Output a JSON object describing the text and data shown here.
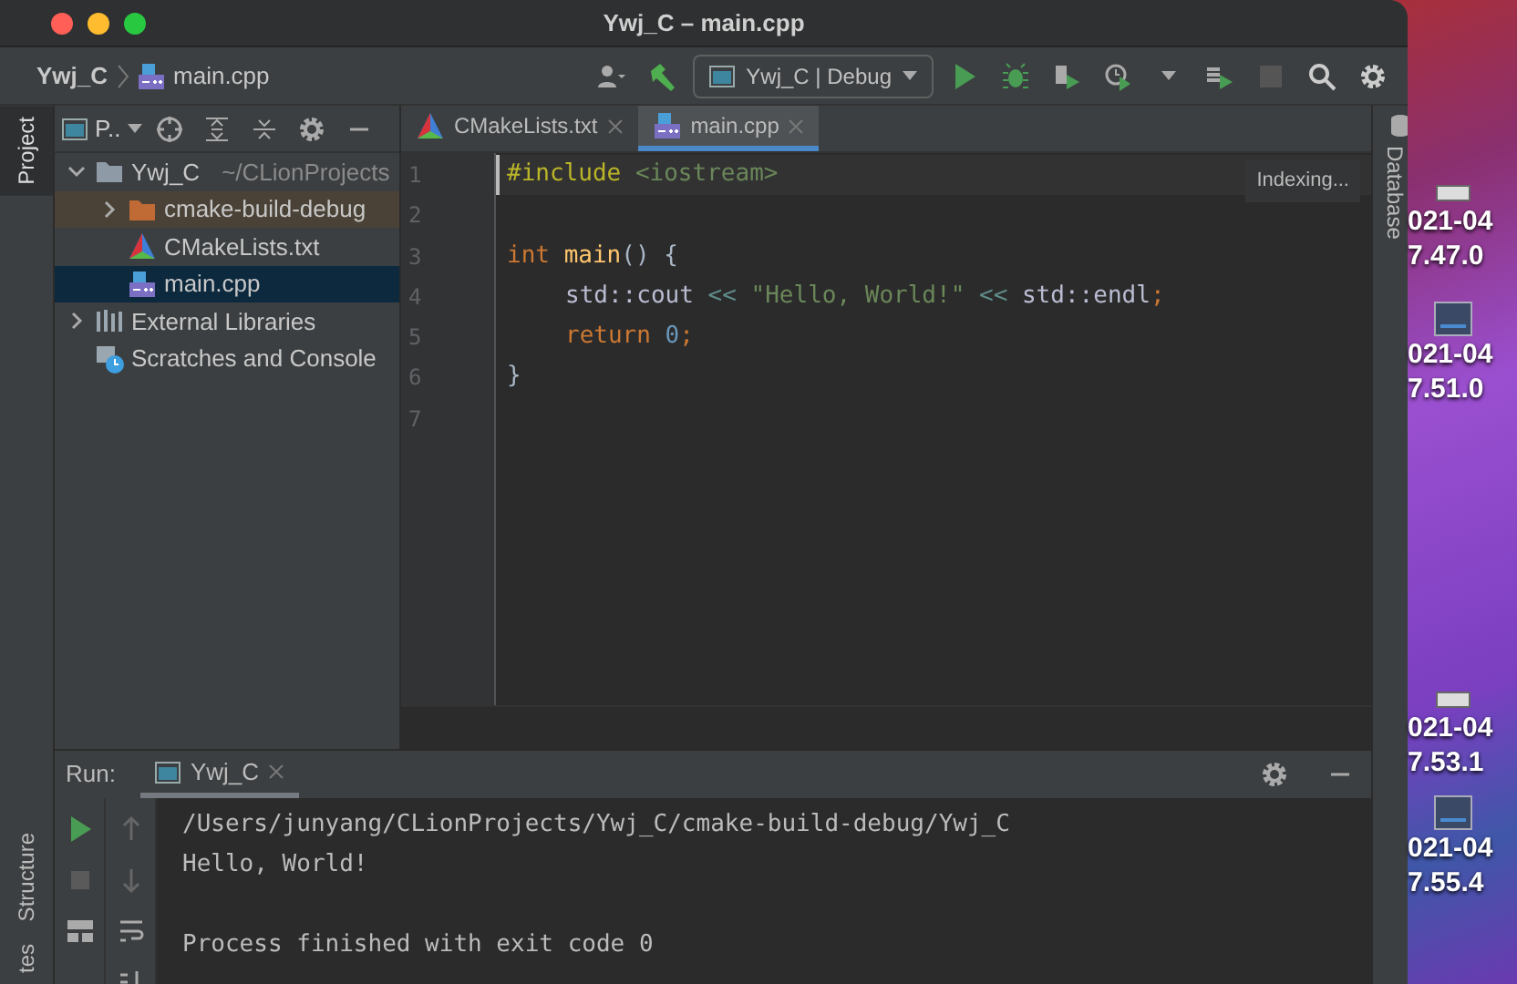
{
  "window": {
    "title": "Ywj_C – main.cpp"
  },
  "breadcrumb": [
    {
      "label": "Ywj_C",
      "kind": "project"
    },
    {
      "label": "main.cpp",
      "kind": "cpp"
    }
  ],
  "run_config": {
    "label": "Ywj_C | Debug"
  },
  "left_strip": {
    "top": [
      {
        "label": "Project",
        "selected": true
      }
    ],
    "bottom": [
      {
        "label": "Structure",
        "selected": false
      },
      {
        "label": "tes",
        "selected": false
      }
    ]
  },
  "right_strip": [
    {
      "label": "Database"
    }
  ],
  "project_panel": {
    "title": "P..",
    "tree": [
      {
        "label": "Ywj_C",
        "hint": "~/CLionProjects",
        "kind": "folder",
        "expanded": true,
        "selected": false,
        "children": [
          {
            "label": "cmake-build-debug",
            "kind": "excluded_folder",
            "expanded": false,
            "selected": false
          },
          {
            "label": "CMakeLists.txt",
            "kind": "cmake",
            "selected": false
          },
          {
            "label": "main.cpp",
            "kind": "cpp",
            "selected": true
          }
        ]
      },
      {
        "label": "External Libraries",
        "kind": "libraries",
        "expanded": false,
        "selected": false
      },
      {
        "label": "Scratches and Console",
        "kind": "scratches",
        "selected": false
      }
    ]
  },
  "editor": {
    "tabs": [
      {
        "label": "CMakeLists.txt",
        "kind": "cmake",
        "selected": false
      },
      {
        "label": "main.cpp",
        "kind": "cpp",
        "selected": true
      }
    ],
    "status": "Indexing...",
    "lines": [
      {
        "number": "1",
        "current": true,
        "tokens": [
          {
            "kind": "directive",
            "text": "#include "
          },
          {
            "kind": "header",
            "text": "<iostream>"
          }
        ]
      },
      {
        "number": "2",
        "current": false
      },
      {
        "number": "3",
        "current": false,
        "tokens": [
          {
            "kind": "keyword",
            "text": "int "
          },
          {
            "kind": "function",
            "text": "main"
          },
          {
            "kind": "plain",
            "text": "() {"
          }
        ]
      },
      {
        "number": "4",
        "current": false,
        "kind": "body",
        "tokens": [
          {
            "kind": "symbol",
            "text": "std::cout"
          },
          {
            "kind": "operator",
            "text": " << "
          },
          {
            "kind": "string",
            "text": "\"Hello, World!\""
          },
          {
            "kind": "operator",
            "text": " << "
          },
          {
            "kind": "symbol",
            "text": "std::endl"
          },
          {
            "kind": "keyword",
            "text": ";"
          }
        ]
      },
      {
        "number": "5",
        "current": false,
        "kind": "body",
        "tokens": [
          {
            "kind": "keyword",
            "text": "return "
          },
          {
            "kind": "number",
            "text": "0"
          },
          {
            "kind": "keyword",
            "text": ";"
          }
        ]
      },
      {
        "number": "6",
        "current": false,
        "tokens": [
          {
            "kind": "plain",
            "text": "}"
          }
        ]
      },
      {
        "number": "7",
        "current": false
      }
    ]
  },
  "run_panel": {
    "label": "Run:",
    "tabs": [
      {
        "label": "Ywj_C",
        "selected": true
      }
    ],
    "output": [
      {
        "kind": "stdout",
        "text": "/Users/junyang/CLionProjects/Ywj_C/cmake-build-debug/Ywj_C"
      },
      {
        "kind": "stdout",
        "text": "Hello, World!"
      },
      {
        "kind": "status",
        "text": "Process finished with exit code 0"
      }
    ]
  },
  "desktop_icons": [
    {
      "kind": "drive",
      "lines": [
        "021-04",
        "7.47.0"
      ]
    },
    {
      "kind": "screen",
      "lines": [
        "021-04",
        "7.51.0"
      ]
    },
    {
      "kind": "drive",
      "lines": [
        "021-04",
        "7.53.1"
      ]
    },
    {
      "kind": "screen",
      "lines": [
        "021-04",
        "7.55.4"
      ]
    }
  ]
}
